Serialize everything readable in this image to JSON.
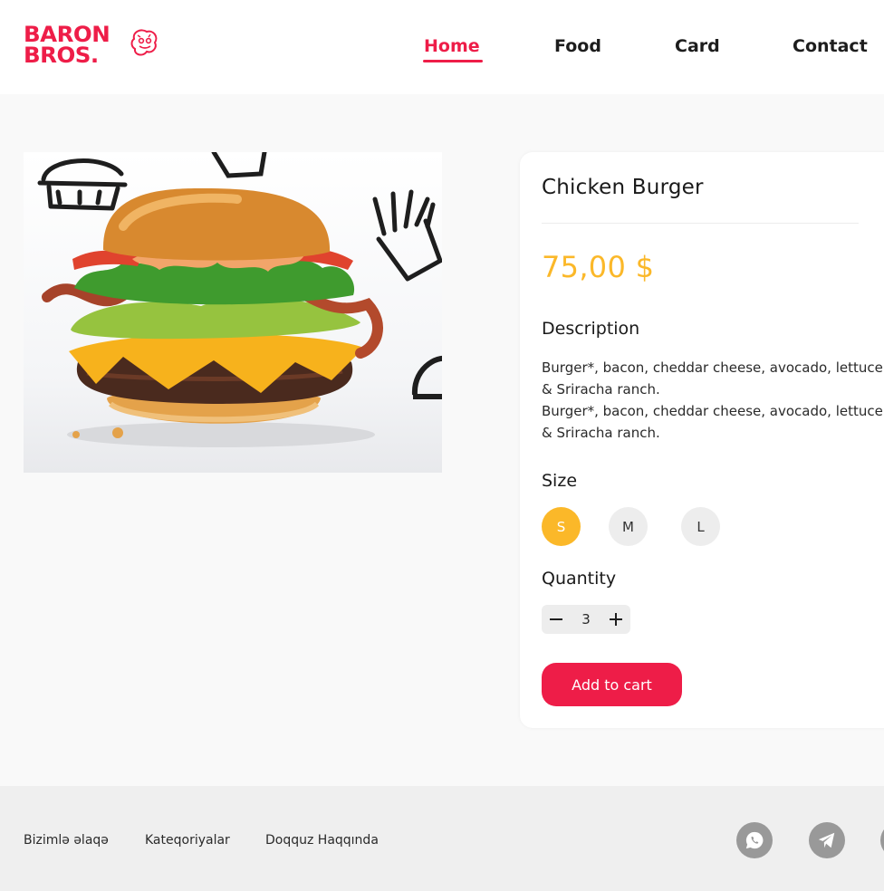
{
  "header": {
    "logo_text": "BARON BROS.",
    "nav": [
      {
        "label": "Home",
        "active": true
      },
      {
        "label": "Food",
        "active": false
      },
      {
        "label": "Card",
        "active": false
      },
      {
        "label": "Contact",
        "active": false
      }
    ]
  },
  "product": {
    "image_icon": "burger-photo",
    "title": "Chicken Burger",
    "price": "75,00 $",
    "description_title": "Description",
    "description": "Burger*, bacon, cheddar cheese, avocado, lettuce\n& Sriracha ranch.\nBurger*, bacon, cheddar cheese, avocado, lettuce\n& Sriracha ranch.",
    "size_title": "Size",
    "sizes": [
      "S",
      "M",
      "L"
    ],
    "selected_size": "S",
    "quantity_title": "Quantity",
    "quantity": "3",
    "add_to_cart": "Add to cart"
  },
  "footer": {
    "links": [
      "Bizimlə əlaqə",
      "Kateqoriyalar",
      "Doqquz Haqqında"
    ],
    "social_icons": [
      "whatsapp-icon",
      "telegram-icon",
      "instagram-icon"
    ]
  },
  "colors": {
    "brand_red": "#ee1d48",
    "accent_yellow": "#fbb829",
    "social_grey": "#999999"
  }
}
